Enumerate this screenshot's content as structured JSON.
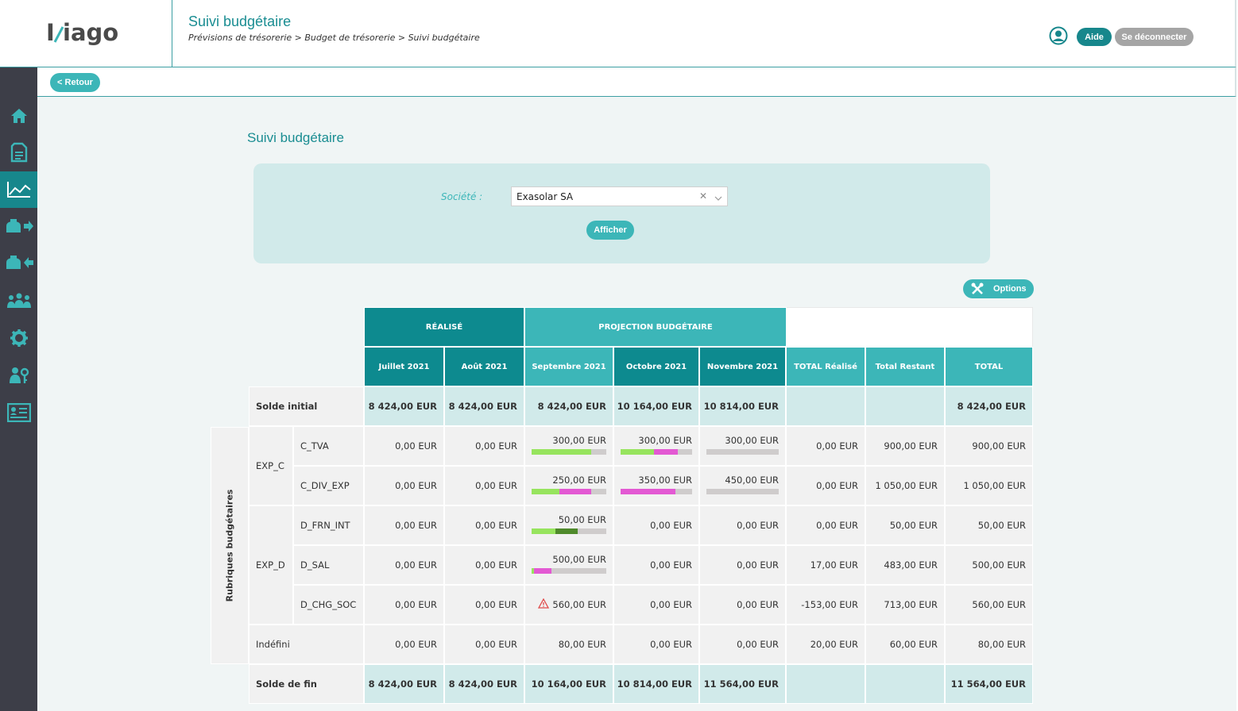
{
  "app": {
    "logo": "Iziago"
  },
  "header": {
    "title": "Suivi budgétaire",
    "breadcrumb": "Prévisions de trésorerie > Budget de trésorerie > Suivi budgétaire",
    "help_label": "Aide",
    "logout_label": "Se déconnecter"
  },
  "subbar": {
    "back_label": "< Retour"
  },
  "sidebar": {
    "items": [
      {
        "icon": "home-icon"
      },
      {
        "icon": "document-icon"
      },
      {
        "icon": "chart-line-icon",
        "active": true
      },
      {
        "icon": "cash-out-icon"
      },
      {
        "icon": "cash-in-icon"
      },
      {
        "icon": "users-icon"
      },
      {
        "icon": "gear-icon"
      },
      {
        "icon": "user-key-icon"
      },
      {
        "icon": "id-card-icon"
      }
    ]
  },
  "main": {
    "section_title": "Suivi budgétaire",
    "filter": {
      "company_label": "Société :",
      "company_value": "Exasolar SA",
      "show_label": "Afficher"
    },
    "options_label": "Options"
  },
  "table": {
    "group_headers": {
      "realise": "RÉALISÉ",
      "projection": "PROJECTION BUDGÉTAIRE"
    },
    "columns": [
      "Juillet 2021",
      "Août 2021",
      "Septembre 2021",
      "Octobre 2021",
      "Novembre 2021",
      "TOTAL Réalisé",
      "Total Restant",
      "TOTAL"
    ],
    "vertical_label": "Rubriques budgétaires",
    "solde_initial": {
      "label": "Solde initial",
      "values": [
        "8 424,00 EUR",
        "8 424,00 EUR",
        "8 424,00 EUR",
        "10 164,00 EUR",
        "10 814,00 EUR",
        "",
        "",
        "8 424,00 EUR"
      ]
    },
    "groups": [
      {
        "name": "EXP_C",
        "rows": [
          {
            "code": "C_TVA",
            "values": [
              "0,00 EUR",
              "0,00 EUR",
              "300,00 EUR",
              "300,00 EUR",
              "300,00 EUR",
              "0,00 EUR",
              "900,00 EUR",
              "900,00 EUR"
            ]
          },
          {
            "code": "C_DIV_EXP",
            "values": [
              "0,00 EUR",
              "0,00 EUR",
              "250,00 EUR",
              "350,00 EUR",
              "450,00 EUR",
              "0,00 EUR",
              "1 050,00 EUR",
              "1 050,00 EUR"
            ]
          }
        ]
      },
      {
        "name": "EXP_D",
        "rows": [
          {
            "code": "D_FRN_INT",
            "values": [
              "0,00 EUR",
              "0,00 EUR",
              "50,00 EUR",
              "0,00 EUR",
              "0,00 EUR",
              "0,00 EUR",
              "50,00 EUR",
              "50,00 EUR"
            ]
          },
          {
            "code": "D_SAL",
            "values": [
              "0,00 EUR",
              "0,00 EUR",
              "500,00 EUR",
              "0,00 EUR",
              "0,00 EUR",
              "17,00 EUR",
              "483,00 EUR",
              "500,00 EUR"
            ]
          },
          {
            "code": "D_CHG_SOC",
            "values": [
              "0,00 EUR",
              "0,00 EUR",
              "560,00 EUR",
              "0,00 EUR",
              "0,00 EUR",
              "-153,00 EUR",
              "713,00 EUR",
              "560,00 EUR"
            ]
          }
        ]
      }
    ],
    "indefini": {
      "label": "Indéfini",
      "values": [
        "0,00 EUR",
        "0,00 EUR",
        "80,00 EUR",
        "0,00 EUR",
        "0,00 EUR",
        "20,00 EUR",
        "60,00 EUR",
        "80,00 EUR"
      ]
    },
    "solde_fin": {
      "label": "Solde de fin",
      "values": [
        "8 424,00 EUR",
        "8 424,00 EUR",
        "10 164,00 EUR",
        "10 814,00 EUR",
        "11 564,00 EUR",
        "",
        "",
        "11 564,00 EUR"
      ]
    },
    "progress": {
      "C_TVA": [
        {
          "green": 0.8,
          "magenta": 0
        },
        {
          "green": 0.47,
          "magenta": 0.33
        },
        {
          "green": 0,
          "magenta": 0
        }
      ],
      "C_DIV_EXP": [
        {
          "green": 0.37,
          "magenta": 0.43
        },
        {
          "green": 0,
          "magenta": 0.77
        },
        {
          "green": 0,
          "magenta": 0
        }
      ],
      "D_FRN_INT": [
        {
          "green": 0.32,
          "darkgreen": 0.3
        }
      ],
      "D_SAL": [
        {
          "green": 0.03,
          "magenta": 0.24
        }
      ]
    },
    "warning_row": "D_CHG_SOC"
  },
  "colors": {
    "teal_dark": "#0d8a8f",
    "teal_light": "#3cb6b8",
    "bar_green": "#97e45e",
    "bar_magenta": "#e359d3",
    "bar_darkgreen": "#4f8a2b",
    "bar_track": "#cfcccc"
  }
}
